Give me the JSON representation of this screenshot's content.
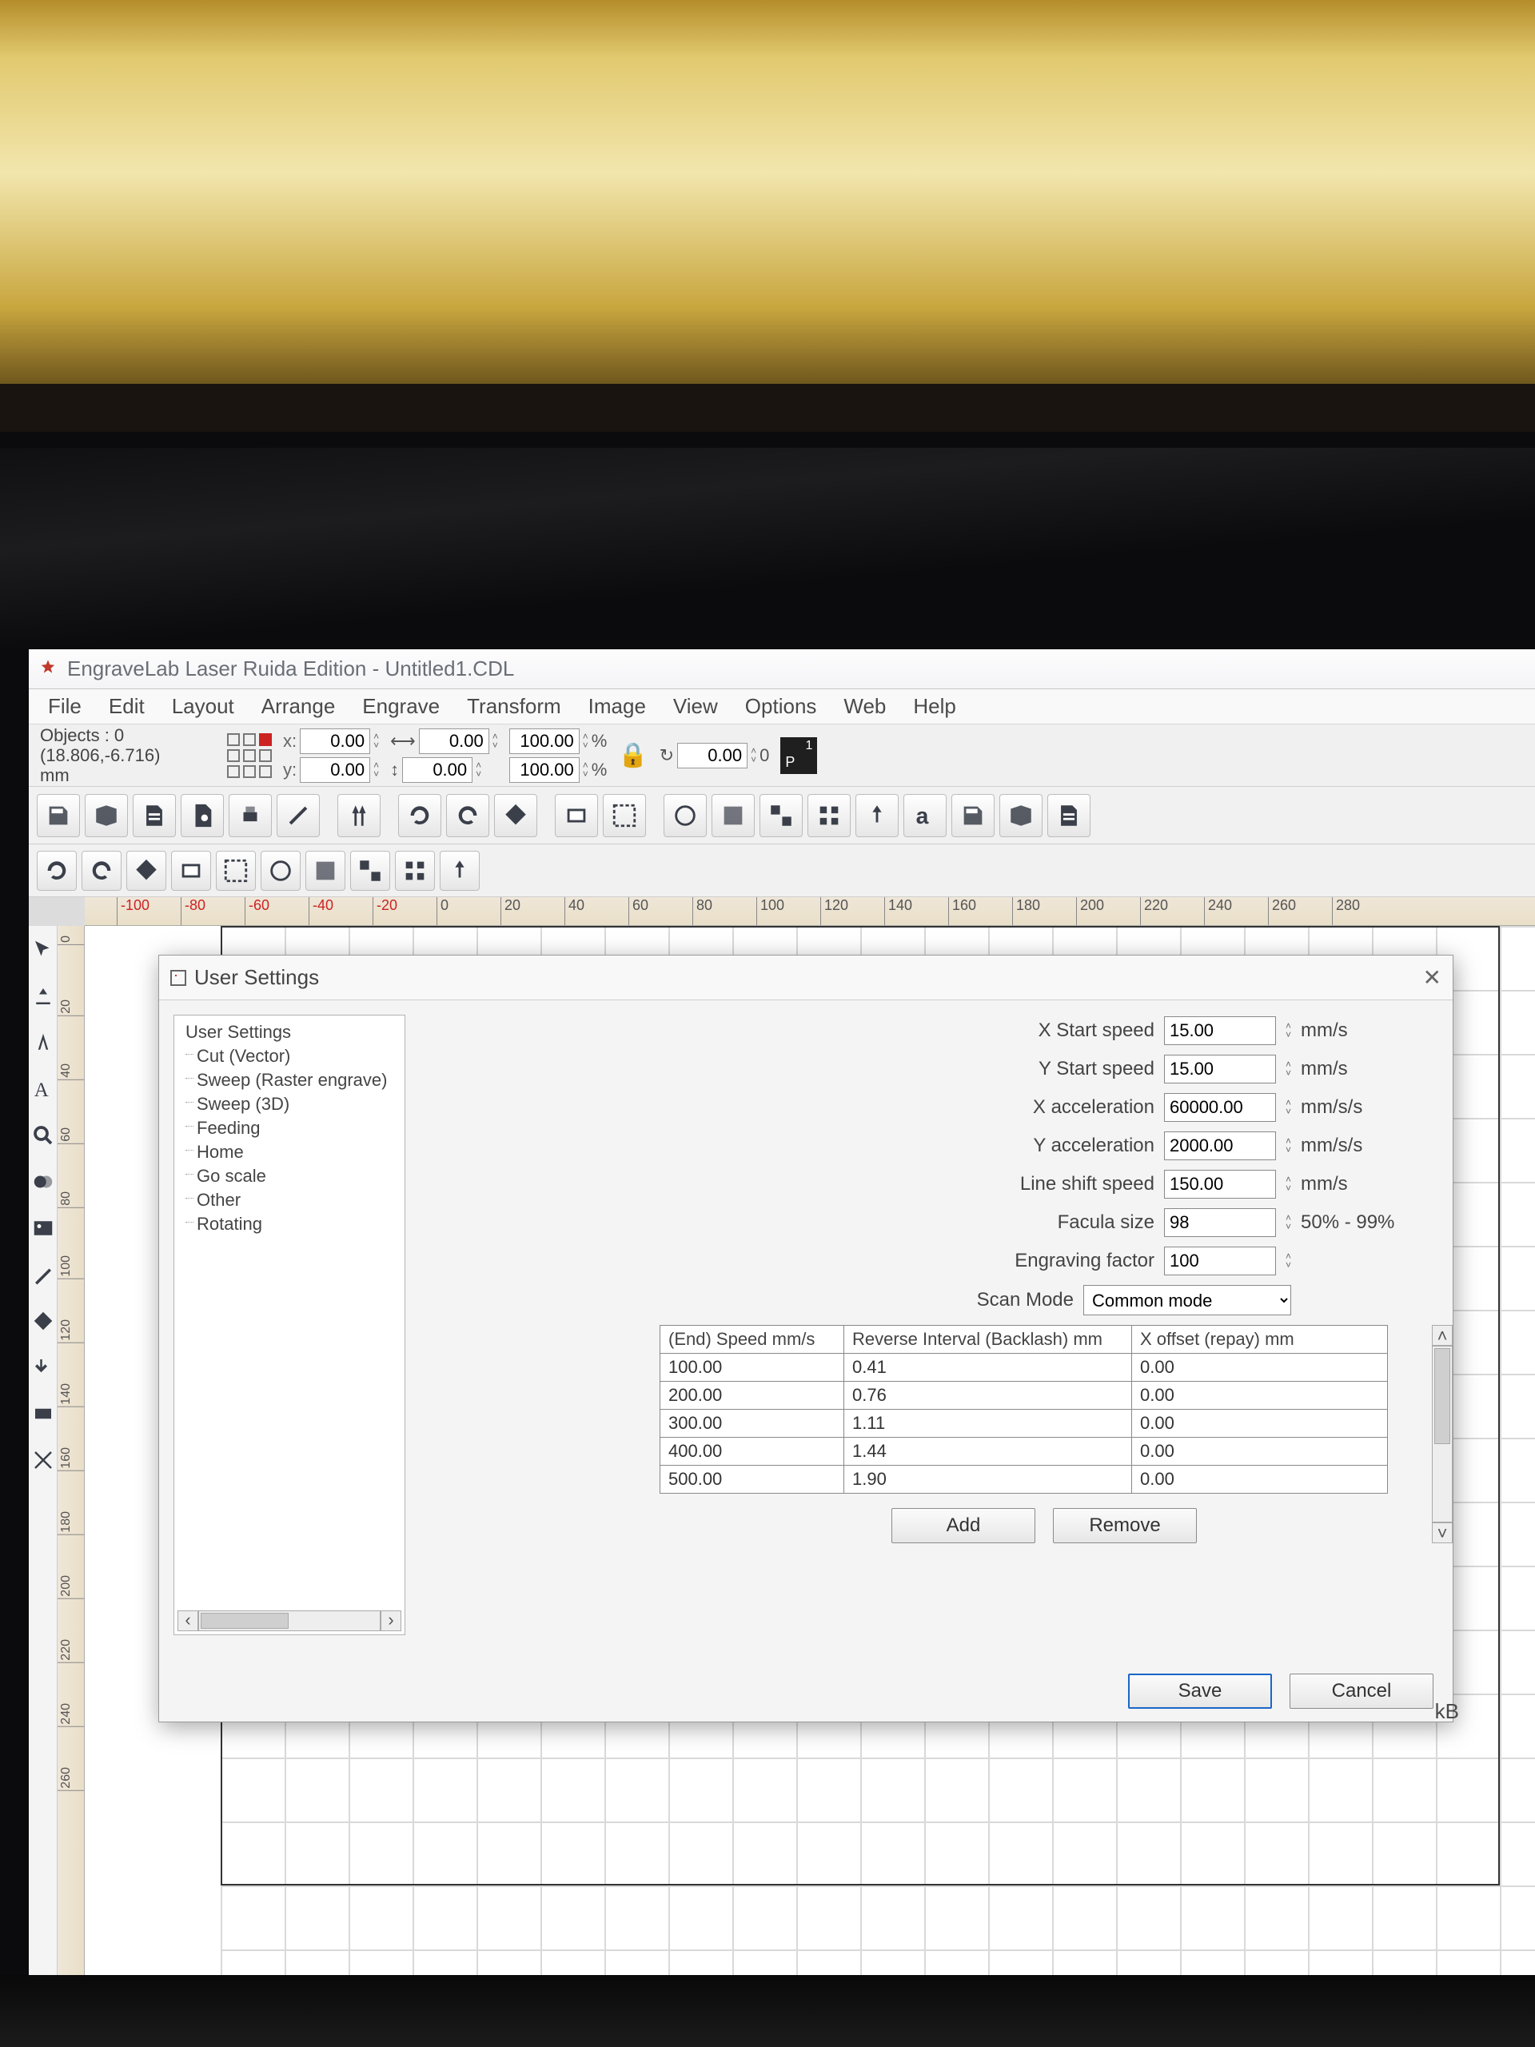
{
  "title": "EngraveLab Laser Ruida Edition - Untitled1.CDL",
  "menubar": [
    "File",
    "Edit",
    "Layout",
    "Arrange",
    "Engrave",
    "Transform",
    "Image",
    "View",
    "Options",
    "Web",
    "Help"
  ],
  "propbar": {
    "objects_line": "Objects : 0",
    "coords_line": "(18.806,-6.716)",
    "units": "mm",
    "x": "0.00",
    "y": "0.00",
    "w": "0.00",
    "h": "0.00",
    "sx": "100.00",
    "sy": "100.00",
    "pct": "%",
    "rot": "0.00",
    "deg": "0"
  },
  "ruler_h": [
    {
      "v": "-100",
      "px": 40,
      "neg": true
    },
    {
      "v": "-80",
      "px": 120,
      "neg": true
    },
    {
      "v": "-60",
      "px": 200,
      "neg": true
    },
    {
      "v": "-40",
      "px": 280,
      "neg": true
    },
    {
      "v": "-20",
      "px": 360,
      "neg": true
    },
    {
      "v": "0",
      "px": 440
    },
    {
      "v": "20",
      "px": 520
    },
    {
      "v": "40",
      "px": 600
    },
    {
      "v": "60",
      "px": 680
    },
    {
      "v": "80",
      "px": 760
    },
    {
      "v": "100",
      "px": 840
    },
    {
      "v": "120",
      "px": 920
    },
    {
      "v": "140",
      "px": 1000
    },
    {
      "v": "160",
      "px": 1080
    },
    {
      "v": "180",
      "px": 1160
    },
    {
      "v": "200",
      "px": 1240
    },
    {
      "v": "220",
      "px": 1320
    },
    {
      "v": "240",
      "px": 1400
    },
    {
      "v": "260",
      "px": 1480
    },
    {
      "v": "280",
      "px": 1560
    }
  ],
  "ruler_v": [
    {
      "v": "0",
      "px": 10
    },
    {
      "v": "20",
      "px": 90
    },
    {
      "v": "40",
      "px": 170
    },
    {
      "v": "60",
      "px": 250
    },
    {
      "v": "80",
      "px": 330
    },
    {
      "v": "100",
      "px": 410
    },
    {
      "v": "120",
      "px": 490
    },
    {
      "v": "140",
      "px": 570
    },
    {
      "v": "160",
      "px": 650
    },
    {
      "v": "180",
      "px": 730
    },
    {
      "v": "200",
      "px": 810
    },
    {
      "v": "220",
      "px": 890
    },
    {
      "v": "240",
      "px": 970
    },
    {
      "v": "260",
      "px": 1050
    }
  ],
  "dialog": {
    "title": "User Settings",
    "tree_root": "User Settings",
    "tree_items": [
      "Cut (Vector)",
      "Sweep (Raster engrave)",
      "Sweep (3D)",
      "Feeding",
      "Home",
      "Go scale",
      "Other",
      "Rotating"
    ],
    "fields": {
      "x_start_label": "X Start speed",
      "x_start": "15.00",
      "x_start_unit": "mm/s",
      "y_start_label": "Y Start speed",
      "y_start": "15.00",
      "y_start_unit": "mm/s",
      "x_acc_label": "X acceleration",
      "x_acc": "60000.00",
      "x_acc_unit": "mm/s/s",
      "y_acc_label": "Y acceleration",
      "y_acc": "2000.00",
      "y_acc_unit": "mm/s/s",
      "lineshift_label": "Line shift speed",
      "lineshift": "150.00",
      "lineshift_unit": "mm/s",
      "facula_label": "Facula size",
      "facula": "98",
      "facula_unit": "50% - 99%",
      "engfactor_label": "Engraving factor",
      "engfactor": "100",
      "engfactor_unit": "",
      "scanmode_label": "Scan Mode",
      "scanmode": "Common mode"
    },
    "table": {
      "headers": [
        "(End) Speed mm/s",
        "Reverse Interval (Backlash) mm",
        "X offset (repay) mm"
      ],
      "rows": [
        [
          "100.00",
          "0.41",
          "0.00"
        ],
        [
          "200.00",
          "0.76",
          "0.00"
        ],
        [
          "300.00",
          "1.11",
          "0.00"
        ],
        [
          "400.00",
          "1.44",
          "0.00"
        ],
        [
          "500.00",
          "1.90",
          "0.00"
        ]
      ]
    },
    "buttons": {
      "add": "Add",
      "remove": "Remove",
      "save": "Save",
      "cancel": "Cancel"
    }
  },
  "kb_label": "kB"
}
